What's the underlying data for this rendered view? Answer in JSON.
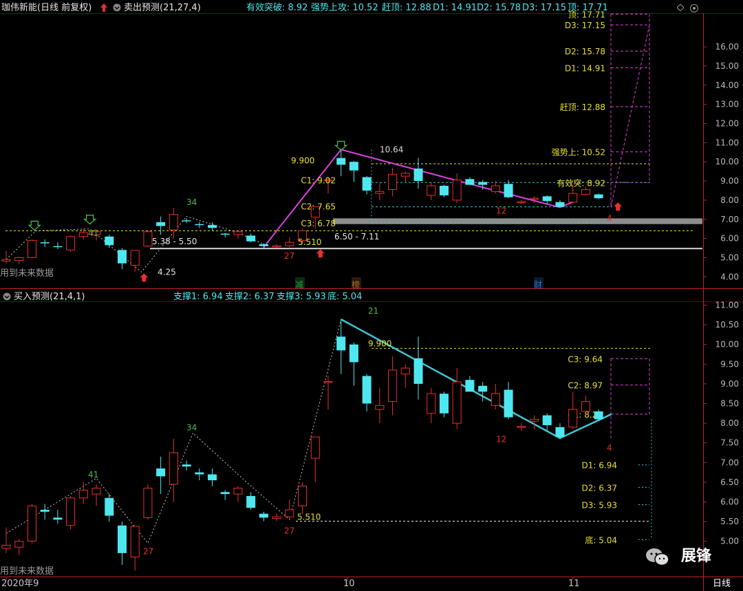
{
  "header": {
    "stock_title": "珈伟新能(日线 前复权)",
    "upper_indicator": "卖出预测(21,27,4)",
    "upper_values": [
      "有效突破: 8.92",
      "强势上攻: 10.52",
      "赶顶: 12.88",
      "D1: 14.91",
      "D2: 15.78",
      "D3: 17.15",
      "顶: 17.71"
    ],
    "lower_indicator": "买入预测(21,4,1)",
    "lower_values": [
      "支撑1: 6.94",
      "支撑2: 6.37",
      "支撑3: 5.93",
      "底: 5.04"
    ]
  },
  "colors": {
    "up": "#e8302f",
    "down": "#4fe7ef",
    "magenta_line": "#e040e0",
    "cyan_line": "#3ec6d4",
    "yellow": "#e8e030",
    "axis": "#c8202a",
    "tick_text": "#b8b8b8"
  },
  "watermarks": {
    "upper": "用到未来数据",
    "lower": "用到未来数据",
    "brand": "展锋"
  },
  "timeframe_label": "日线",
  "x_axis": {
    "labels": [
      "2020年9",
      "10",
      "11"
    ]
  },
  "event_markers": [
    {
      "label": "减",
      "color": "#1fa03a"
    },
    {
      "label": "榜",
      "color": "#b06a2a"
    },
    {
      "label": "财",
      "color": "#2a72c8"
    }
  ],
  "chart_data": [
    {
      "type": "candlestick",
      "pane": "upper",
      "y_ticks": [
        "4.00",
        "5.00",
        "6.00",
        "7.00",
        "8.00",
        "9.00",
        "10.00",
        "11.00",
        "12.00",
        "13.00",
        "14.00",
        "15.00",
        "16.00"
      ],
      "ylim": [
        3.6,
        17.7
      ],
      "candles": [
        {
          "o": 4.82,
          "h": 5.35,
          "l": 4.7,
          "c": 4.9
        },
        {
          "o": 4.85,
          "h": 5.05,
          "l": 4.65,
          "c": 5.0
        },
        {
          "o": 5.0,
          "h": 5.95,
          "l": 4.95,
          "c": 5.9
        },
        {
          "o": 5.8,
          "h": 5.95,
          "l": 5.55,
          "c": 5.75
        },
        {
          "o": 5.6,
          "h": 5.8,
          "l": 5.45,
          "c": 5.55
        },
        {
          "o": 5.4,
          "h": 6.15,
          "l": 5.3,
          "c": 6.1
        },
        {
          "o": 6.1,
          "h": 6.5,
          "l": 5.95,
          "c": 6.3
        },
        {
          "o": 6.2,
          "h": 6.45,
          "l": 5.9,
          "c": 6.35
        },
        {
          "o": 6.1,
          "h": 6.2,
          "l": 5.5,
          "c": 5.65
        },
        {
          "o": 5.4,
          "h": 5.5,
          "l": 4.4,
          "c": 4.7
        },
        {
          "o": 4.6,
          "h": 5.38,
          "l": 4.25,
          "c": 5.38
        },
        {
          "o": 5.6,
          "h": 6.45,
          "l": 5.55,
          "c": 6.35
        },
        {
          "o": 6.85,
          "h": 7.15,
          "l": 6.2,
          "c": 6.65
        },
        {
          "o": 6.45,
          "h": 7.6,
          "l": 6.0,
          "c": 7.25
        },
        {
          "o": 6.95,
          "h": 7.05,
          "l": 6.8,
          "c": 6.9
        },
        {
          "o": 6.75,
          "h": 6.85,
          "l": 6.55,
          "c": 6.7
        },
        {
          "o": 6.7,
          "h": 6.85,
          "l": 6.4,
          "c": 6.55
        },
        {
          "o": 6.25,
          "h": 6.3,
          "l": 6.05,
          "c": 6.2
        },
        {
          "o": 6.2,
          "h": 6.4,
          "l": 6.0,
          "c": 6.35
        },
        {
          "o": 6.15,
          "h": 6.25,
          "l": 5.8,
          "c": 5.85
        },
        {
          "o": 5.7,
          "h": 5.75,
          "l": 5.51,
          "c": 5.6
        },
        {
          "o": 5.58,
          "h": 5.7,
          "l": 5.51,
          "c": 5.62
        },
        {
          "o": 5.62,
          "h": 6.05,
          "l": 5.55,
          "c": 5.8
        },
        {
          "o": 5.9,
          "h": 6.5,
          "l": 5.7,
          "c": 6.4
        },
        {
          "o": 7.11,
          "h": 7.65,
          "l": 6.5,
          "c": 7.65
        },
        {
          "o": 9.06,
          "h": 9.2,
          "l": 8.35,
          "c": 9.06
        },
        {
          "o": 10.2,
          "h": 10.64,
          "l": 9.25,
          "c": 9.85
        },
        {
          "o": 10.0,
          "h": 10.05,
          "l": 8.95,
          "c": 9.55
        },
        {
          "o": 9.2,
          "h": 9.25,
          "l": 8.3,
          "c": 8.5
        },
        {
          "o": 8.35,
          "h": 8.9,
          "l": 8.0,
          "c": 8.45
        },
        {
          "o": 8.55,
          "h": 9.7,
          "l": 8.2,
          "c": 9.35
        },
        {
          "o": 9.25,
          "h": 9.5,
          "l": 8.9,
          "c": 9.4
        },
        {
          "o": 9.65,
          "h": 10.2,
          "l": 8.6,
          "c": 9.0
        },
        {
          "o": 8.25,
          "h": 8.9,
          "l": 8.0,
          "c": 8.75
        },
        {
          "o": 8.75,
          "h": 8.8,
          "l": 8.15,
          "c": 8.25
        },
        {
          "o": 8.0,
          "h": 9.4,
          "l": 7.85,
          "c": 9.05
        },
        {
          "o": 9.1,
          "h": 9.2,
          "l": 8.8,
          "c": 8.8
        },
        {
          "o": 8.95,
          "h": 9.05,
          "l": 8.55,
          "c": 8.8
        },
        {
          "o": 8.45,
          "h": 9.0,
          "l": 8.35,
          "c": 8.75
        },
        {
          "o": 8.85,
          "h": 9.05,
          "l": 8.1,
          "c": 8.15
        },
        {
          "o": 7.9,
          "h": 8.0,
          "l": 7.8,
          "c": 7.92
        },
        {
          "o": 8.05,
          "h": 8.2,
          "l": 7.85,
          "c": 8.1
        },
        {
          "o": 8.2,
          "h": 8.25,
          "l": 7.8,
          "c": 7.95
        },
        {
          "o": 7.9,
          "h": 8.0,
          "l": 7.62,
          "c": 7.65
        },
        {
          "o": 7.9,
          "h": 8.8,
          "l": 7.85,
          "c": 8.35
        },
        {
          "o": 8.3,
          "h": 8.7,
          "l": 8.25,
          "c": 8.55
        },
        {
          "o": 8.3,
          "h": 8.35,
          "l": 8.05,
          "c": 8.1
        }
      ],
      "levels": [
        {
          "label": "顶: 17.71",
          "value": 17.71
        },
        {
          "label": "D3: 17.15",
          "value": 17.15
        },
        {
          "label": "D2: 15.78",
          "value": 15.78
        },
        {
          "label": "D1: 14.91",
          "value": 14.91
        },
        {
          "label": "赶顶: 12.88",
          "value": 12.88
        },
        {
          "label": "强势上: 10.52",
          "value": 10.52
        },
        {
          "label": "有效突: 8.92",
          "value": 8.92
        }
      ],
      "wave_labels": [
        {
          "text": "C1: 9.02",
          "value": 9.02
        },
        {
          "text": "C2: 7.65",
          "value": 7.65
        },
        {
          "text": "C3: 6.78",
          "value": 6.78
        }
      ],
      "annotations": [
        "9.900",
        "10.64",
        "5.510",
        "6.50 - 7.11",
        "5.38 - 5.50",
        "4.25",
        "34",
        "41",
        "27",
        "12",
        "4"
      ],
      "references": {
        "y_9_900": 9.9,
        "y_5_510": 5.51,
        "y_8_92": 8.92,
        "y_7_65": 7.65,
        "y_6_78": 6.78,
        "y_6_40": 6.4,
        "zone_top": 7.05,
        "zone_bottom": 6.75
      }
    },
    {
      "type": "candlestick",
      "pane": "lower",
      "y_ticks": [
        "5.00",
        "5.50",
        "6.00",
        "6.50",
        "7.00",
        "7.50",
        "8.00",
        "8.50",
        "9.00",
        "9.50",
        "10.00",
        "10.50",
        "11.00"
      ],
      "ylim": [
        4.8,
        11.2
      ],
      "levels": [
        {
          "label": "C3: 9.64",
          "value": 9.64
        },
        {
          "label": "C2: 8.97",
          "value": 8.97
        },
        {
          "label": "C1: 8.23",
          "value": 8.23
        }
      ],
      "support_labels": [
        {
          "label": "D1: 6.94",
          "value": 6.94
        },
        {
          "label": "D2: 6.37",
          "value": 6.37
        },
        {
          "label": "D3: 5.93",
          "value": 5.93
        },
        {
          "label": "底: 5.04",
          "value": 5.04
        }
      ],
      "annotations": [
        "9.900",
        "5.510",
        "21",
        "34",
        "41",
        "27",
        "27",
        "12",
        "4"
      ],
      "references": {
        "y_9_900": 9.9,
        "y_5_510": 5.51
      }
    }
  ]
}
